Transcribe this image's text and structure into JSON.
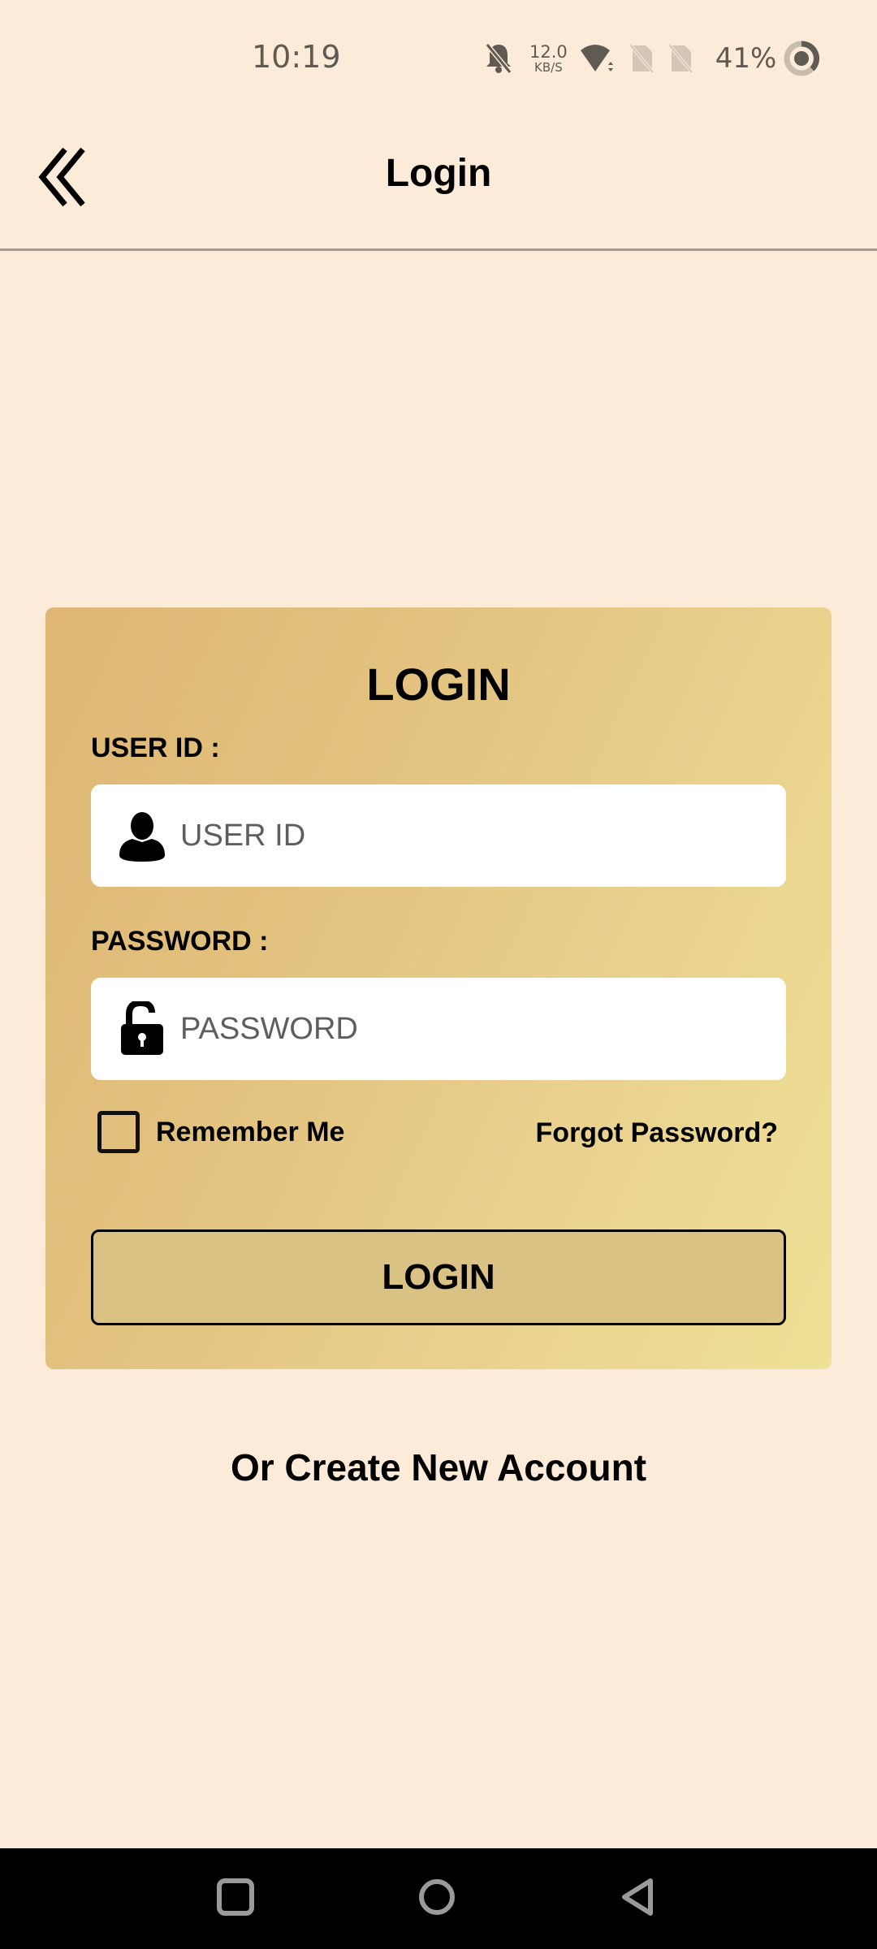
{
  "status_bar": {
    "time": "10:19",
    "net_speed_value": "12.0",
    "net_speed_unit": "KB/S",
    "battery_percent": "41%",
    "icons": [
      "bell-muted-icon",
      "wifi-icon",
      "sim-none-icon",
      "sim-none-icon",
      "battery-ring-icon"
    ]
  },
  "header": {
    "title": "Login",
    "back_icon": "double-chevron-left-icon"
  },
  "login_card": {
    "title": "LOGIN",
    "user_id": {
      "label": "USER ID :",
      "placeholder": "USER ID",
      "value": "",
      "icon": "user-icon"
    },
    "password": {
      "label": "PASSWORD :",
      "placeholder": "PASSWORD",
      "value": "",
      "icon": "unlock-icon"
    },
    "remember_me": {
      "label": "Remember Me",
      "checked": false
    },
    "forgot_password": "Forgot Password?",
    "login_button": "LOGIN"
  },
  "create_account": "Or Create New Account",
  "nav_bar": {
    "buttons": [
      "recents-icon",
      "home-icon",
      "back-icon"
    ]
  },
  "colors": {
    "background": "#fdebd9",
    "card_gradient_start": "#dfb674",
    "card_gradient_end": "#efe196",
    "login_button": "#dac284",
    "status_icon": "#5f5a52"
  }
}
